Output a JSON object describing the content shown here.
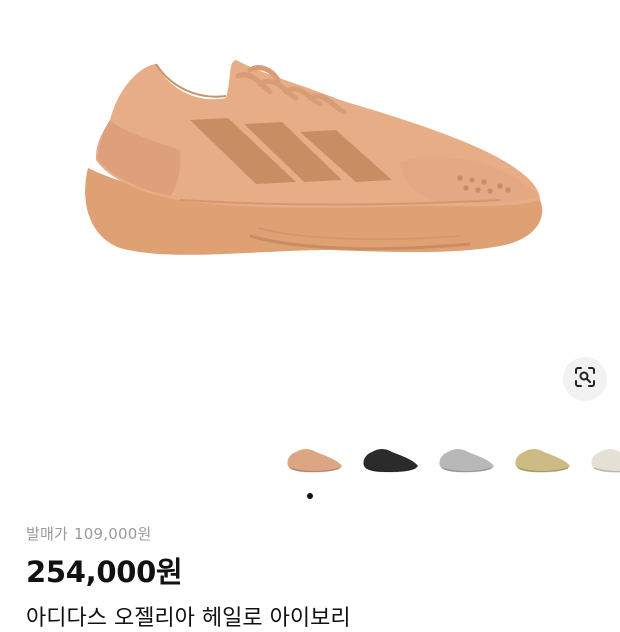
{
  "product": {
    "release_label": "발매가",
    "release_price": "109,000원",
    "price": "254,000원",
    "title": "아디다스 오젤리아 헤일로 아이보리"
  },
  "gallery": {
    "current_index": 1,
    "total_indicators": 1,
    "colorways": [
      {
        "color": "#dca583"
      },
      {
        "color": "#2b2b2b"
      },
      {
        "color": "#b8b8b8"
      },
      {
        "color": "#cdbb84"
      },
      {
        "color": "#e4e0d6"
      }
    ]
  },
  "icons": {
    "lens": "image-search-icon"
  },
  "colors": {
    "shoe_main": "#e7ad87",
    "shoe_stripe": "#c98d63",
    "text_muted": "#9a9a9a",
    "text_main": "#111111"
  }
}
